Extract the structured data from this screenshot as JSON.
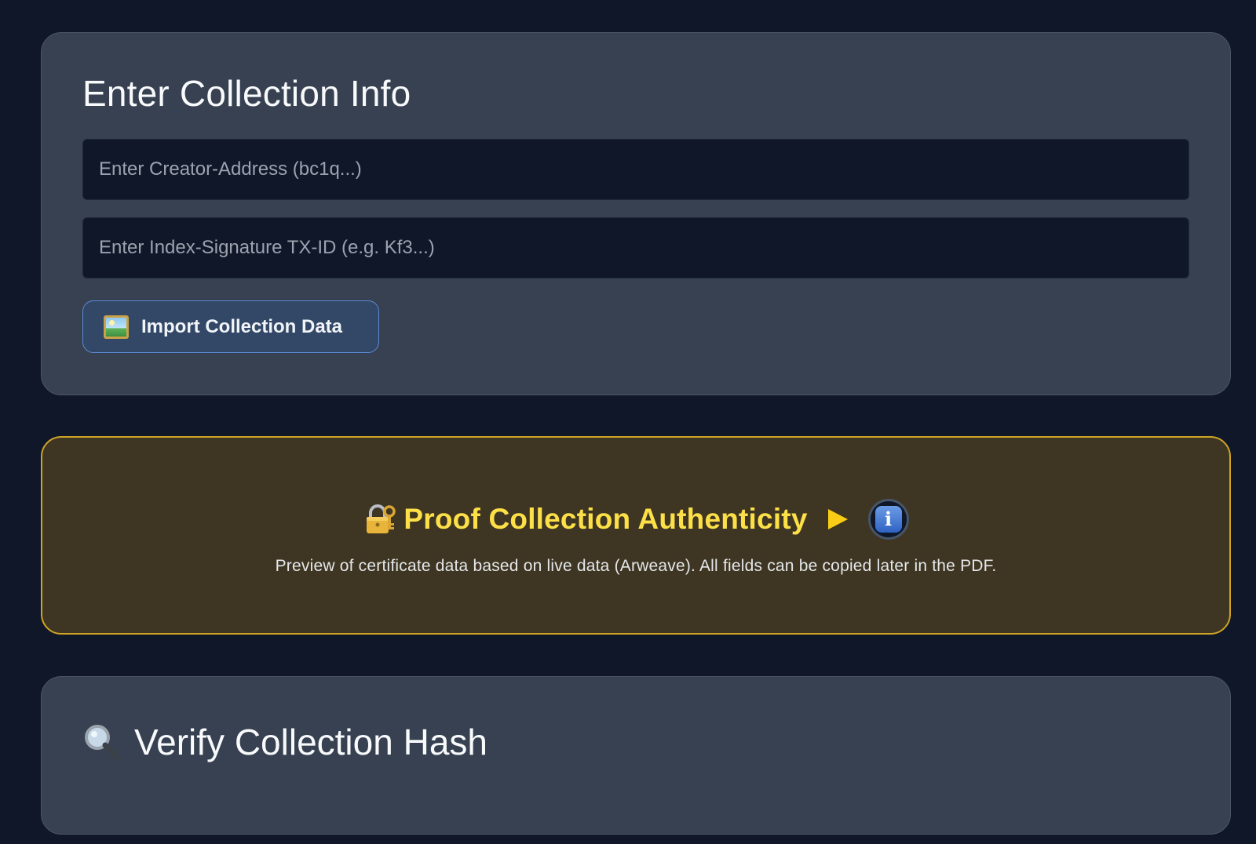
{
  "collection_info": {
    "title": "Enter Collection Info",
    "creator_address": {
      "value": "",
      "placeholder": "Enter Creator-Address (bc1q...)"
    },
    "index_signature": {
      "value": "",
      "placeholder": "Enter Index-Signature TX-ID (e.g. Kf3...)"
    },
    "import_button": {
      "label": "Import Collection Data",
      "icon": "framed-picture-icon"
    }
  },
  "proof": {
    "icon": "lock-with-key-icon",
    "title": "Proof Collection Authenticity",
    "expand_icon": "play-triangle-icon",
    "info_icon": "info-icon",
    "info_glyph": "i",
    "subtitle": "Preview of certificate data based on live data (Arweave). All fields can be copied later in the PDF."
  },
  "verify": {
    "icon": "magnifier-icon",
    "title": "Verify Collection Hash"
  },
  "colors": {
    "background": "#0f1729",
    "card": "#374151",
    "proof_card": "#3e3622",
    "proof_border": "#cfa424",
    "proof_title": "#fde047",
    "button_border": "#5b8bd6"
  }
}
